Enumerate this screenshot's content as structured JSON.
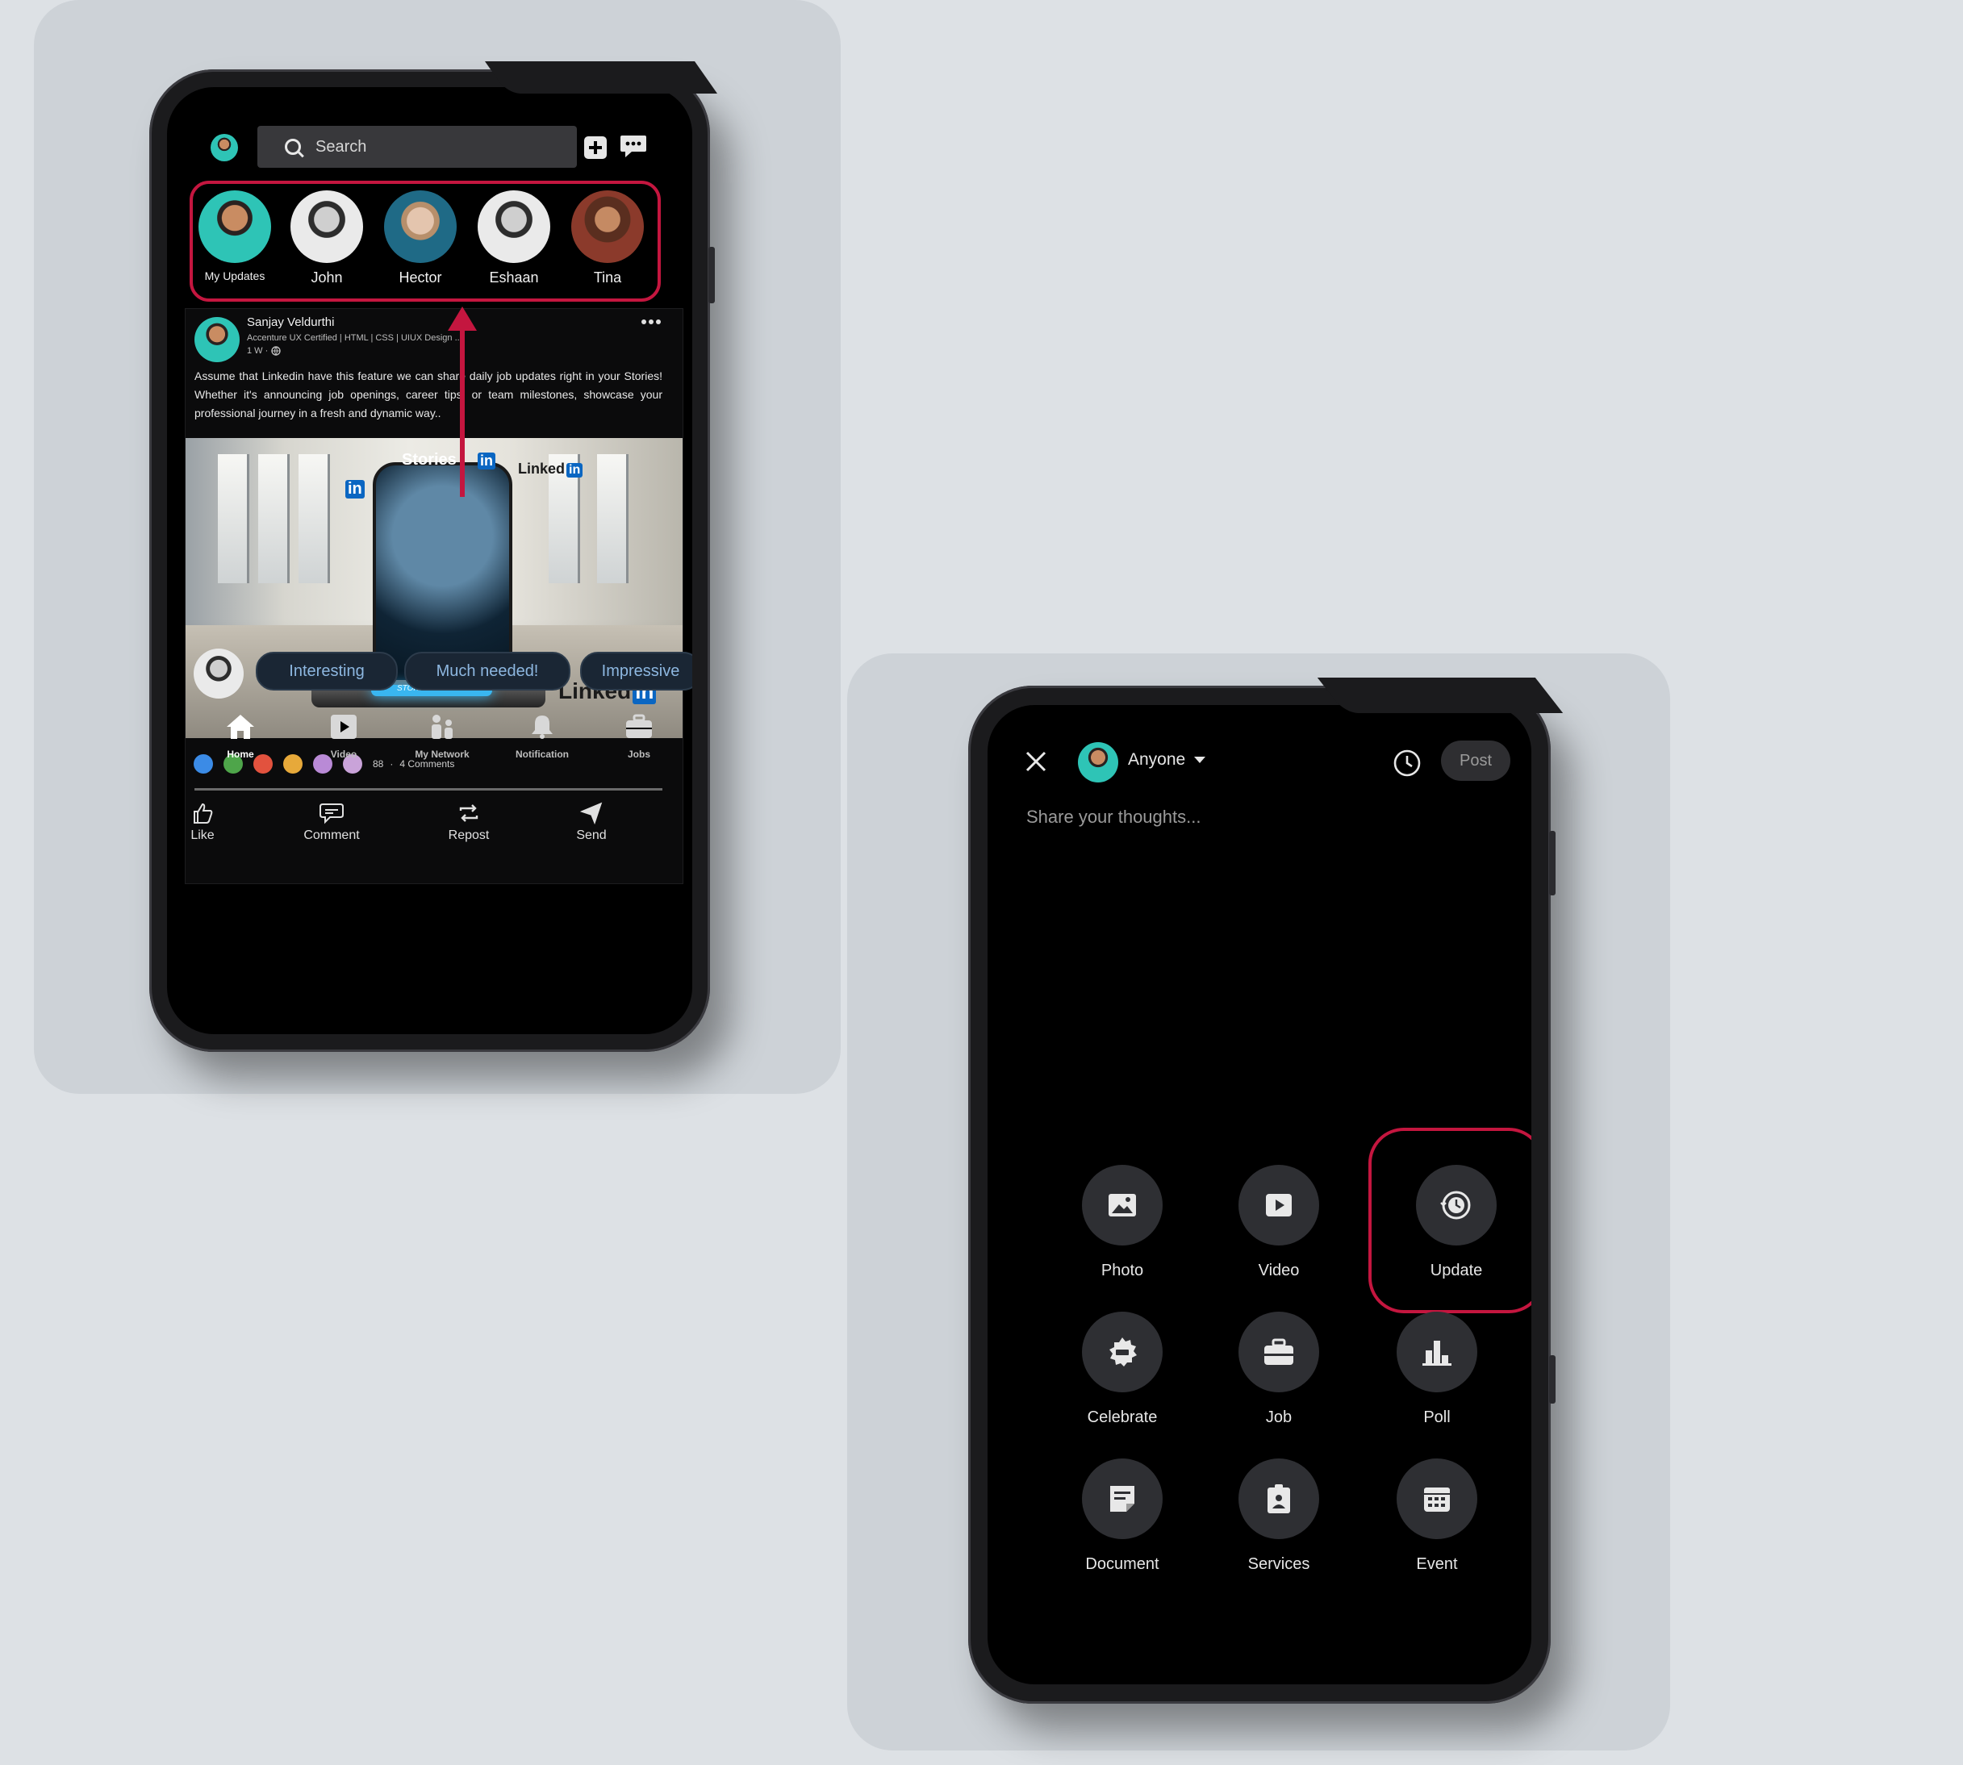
{
  "feed": {
    "search_placeholder": "Search",
    "stories": [
      {
        "name": "My Updates"
      },
      {
        "name": "John"
      },
      {
        "name": "Hector"
      },
      {
        "name": "Eshaan"
      },
      {
        "name": "Tina"
      }
    ],
    "post": {
      "author": "Sanjay Veldurthi",
      "headline": "Accenture UX Certified | HTML | CSS | UIUX Design ....",
      "meta": "1 W ·",
      "text": "Assume that Linkedin have this feature we can share daily job updates right in your Stories! Whether it's announcing job openings, career tips, or team milestones, showcase your professional journey in a fresh and dynamic way..",
      "image_text": {
        "stories": "Stories",
        "linked_small": "Linked",
        "linked_big": "Linked",
        "in": "in",
        "stories_badge": "STORIES"
      },
      "reaction_count": "88",
      "comments": "4 Comments",
      "actions": [
        "Like",
        "Comment",
        "Repost",
        "Send"
      ]
    },
    "quick_replies": [
      "Interesting",
      "Much needed!",
      "Impressive"
    ],
    "bottom_nav": [
      "Home",
      "Video",
      "My Network",
      "Notification",
      "Jobs"
    ]
  },
  "composer": {
    "audience": "Anyone",
    "post_label": "Post",
    "placeholder": "Share your thoughts...",
    "options": [
      "Photo",
      "Video",
      "Update",
      "Celebrate",
      "Job",
      "Poll",
      "Document",
      "Services",
      "Event"
    ]
  },
  "colors": {
    "highlight": "#c4163f",
    "chip_text": "#8db7e0",
    "linkedin_blue": "#0a66c2"
  }
}
